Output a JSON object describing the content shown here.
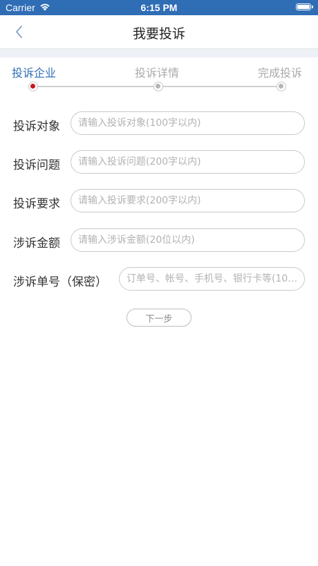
{
  "status_bar": {
    "carrier": "Carrier",
    "time": "6:15 PM"
  },
  "nav": {
    "title": "我要投诉"
  },
  "steps": [
    {
      "label": "投诉企业",
      "active": true
    },
    {
      "label": "投诉详情",
      "active": false
    },
    {
      "label": "完成投诉",
      "active": false
    }
  ],
  "form": {
    "target_label": "投诉对象",
    "target_placeholder": "请输入投诉对象(100字以内)",
    "issue_label": "投诉问题",
    "issue_placeholder": "请输入投诉问题(200字以内)",
    "demand_label": "投诉要求",
    "demand_placeholder": "请输入投诉要求(200字以内)",
    "amount_label": "涉诉金额",
    "amount_placeholder": "请输入涉诉金额(20位以内)",
    "order_label": "涉诉单号（保密）",
    "order_placeholder": "订单号、帐号、手机号、银行卡等(10…"
  },
  "next_button": {
    "label": "下一步"
  }
}
